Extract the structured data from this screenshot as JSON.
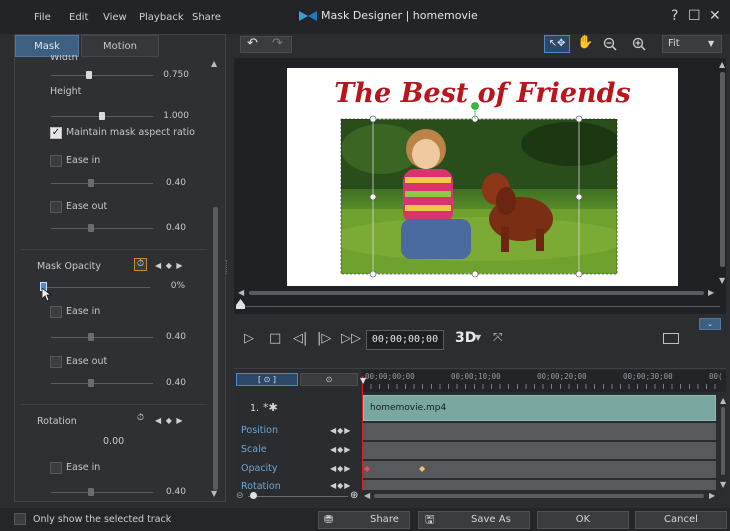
{
  "window": {
    "title": "Mask Designer | homemovie",
    "menu": [
      "File",
      "Edit",
      "View",
      "Playback",
      "Share"
    ],
    "controls": [
      "?",
      "☐",
      "✕"
    ]
  },
  "left_panel": {
    "tabs": [
      "Mask",
      "Motion"
    ],
    "width_label": "Width",
    "width_value": "0.750",
    "height_label": "Height",
    "height_value": "1.000",
    "maintain_ratio_label": "Maintain mask aspect ratio",
    "maintain_ratio_checked": true,
    "size_ease_in_label": "Ease in",
    "size_ease_in_value": "0.40",
    "size_ease_out_label": "Ease out",
    "size_ease_out_value": "0.40",
    "opacity_label": "Mask Opacity",
    "opacity_value": "0%",
    "opacity_ease_in_label": "Ease in",
    "opacity_ease_in_value": "0.40",
    "opacity_ease_out_label": "Ease out",
    "opacity_ease_out_value": "0.40",
    "rotation_label": "Rotation",
    "rotation_value": "0.00",
    "rotation_ease_in_label": "Ease in",
    "rotation_ease_in_value": "0.40"
  },
  "preview": {
    "zoom": "Fit",
    "canvas_title": "The Best of Friends"
  },
  "playback": {
    "timecode": "00;00;00;00",
    "mode_3d": "3D"
  },
  "timeline": {
    "ruler": [
      "00;00;00;00",
      "00;00;10;00",
      "00;00;20;00",
      "00;00;30;00",
      "00("
    ],
    "track_number": "1.",
    "clip_name": "homemovie.mp4",
    "keyframe_tracks": [
      "Position",
      "Scale",
      "Opacity",
      "Rotation"
    ]
  },
  "bottom": {
    "only_selected_label": "Only show the selected track",
    "share_label": "Share",
    "save_as_label": "Save As",
    "ok_label": "OK",
    "cancel_label": "Cancel"
  },
  "colors": {
    "accent": "#3d5f80",
    "clip": "#7aa8a1",
    "keyframe_label": "#6ea6d8",
    "title_red": "#b8161c",
    "playhead": "#d42020"
  }
}
